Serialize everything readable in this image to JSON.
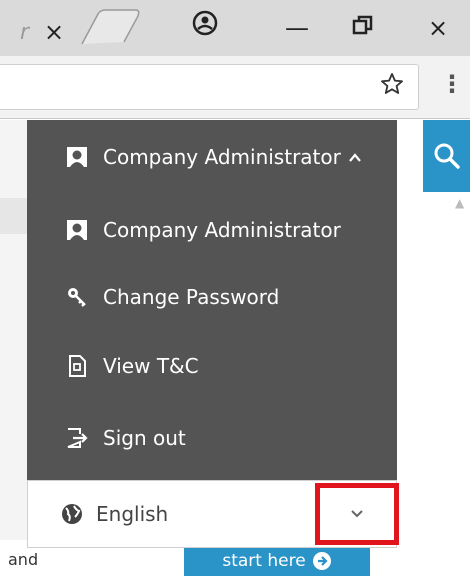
{
  "browser": {
    "tab_fragment": "r",
    "tab_close": "×",
    "window_controls": {
      "profile": "profile-icon",
      "minimize": "—",
      "restore": "restore-icon",
      "close": "×"
    },
    "bookmark": "★",
    "menu": "⋮"
  },
  "menu": {
    "header": {
      "label": "Company Administrator",
      "icon": "user-icon",
      "caret": "^"
    },
    "items": [
      {
        "label": "Company Administrator",
        "icon": "user-icon"
      },
      {
        "label": "Change Password",
        "icon": "key-icon"
      },
      {
        "label": "View T&C",
        "icon": "document-icon"
      },
      {
        "label": "Sign out",
        "icon": "sign-out-icon"
      }
    ]
  },
  "language": {
    "label": "English",
    "icon": "globe-icon",
    "chevron": "⌄"
  },
  "page": {
    "partial_text": "and",
    "start_button": "start here",
    "search_icon": "search-icon"
  },
  "colors": {
    "menu_bg": "#545454",
    "accent": "#2a93c7",
    "highlight": "#e1131c"
  }
}
